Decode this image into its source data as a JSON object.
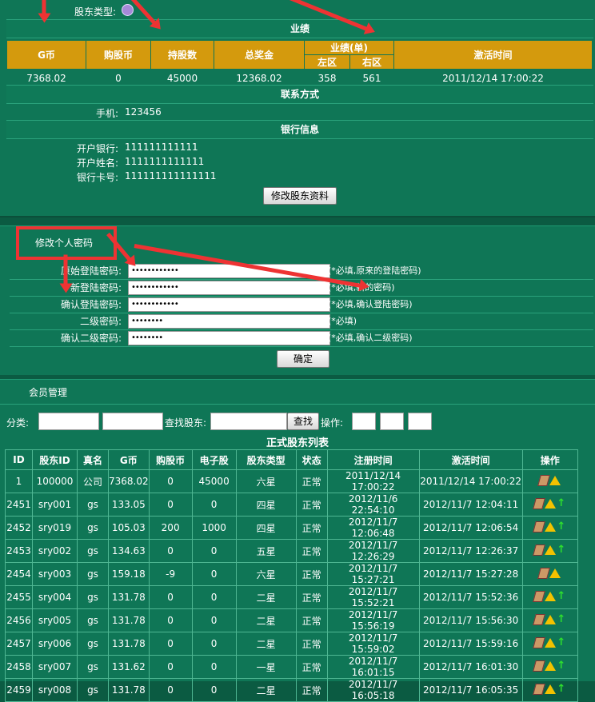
{
  "profile": {
    "type_label": "股东类型:",
    "performance_title": "业绩",
    "perf_headers": {
      "g_coin": "G币",
      "buy_coin": "购股币",
      "shares": "持股数",
      "total_bonus": "总奖金",
      "performance": "业绩(单)",
      "left": "左区",
      "right": "右区",
      "activate_time": "激活时间"
    },
    "perf_values": {
      "g_coin": "7368.02",
      "buy_coin": "0",
      "shares": "45000",
      "total_bonus": "12368.02",
      "left": "358",
      "right": "561",
      "activate_time": "2011/12/14 17:00:22"
    },
    "contact_title": "联系方式",
    "phone_label": "手机:",
    "phone_value": "123456",
    "bank_title": "银行信息",
    "bank_name_label": "开户银行:",
    "bank_name_value": "111111111111",
    "account_name_label": "开户姓名:",
    "account_name_value": "1111111111111",
    "card_label": "银行卡号:",
    "card_value": "111111111111111",
    "edit_button": "修改股东资料"
  },
  "password": {
    "title": "修改个人密码",
    "fields": [
      {
        "label": "原始登陆密码:",
        "value": "••••••••••••",
        "hint": "(*必填,原来的登陆密码)"
      },
      {
        "label": "新登陆密码:",
        "value": "••••••••••••",
        "hint": "(*必填,新的密码)"
      },
      {
        "label": "确认登陆密码:",
        "value": "••••••••••••",
        "hint": "(*必填,确认登陆密码)"
      },
      {
        "label": "二级密码:",
        "value": "••••••••",
        "hint": "(*必填)"
      },
      {
        "label": "确认二级密码:",
        "value": "••••••••",
        "hint": "(*必填,确认二级密码)"
      }
    ],
    "confirm_button": "确定"
  },
  "members": {
    "title": "会员管理",
    "category_label": "分类:",
    "find_label": "查找股东:",
    "find_button": "查找",
    "operate_label": "操作:",
    "list_title": "正式股东列表",
    "headers": [
      "ID",
      "股东ID",
      "真名",
      "G币",
      "购股币",
      "电子股",
      "股东类型",
      "状态",
      "注册时间",
      "激活时间",
      "操作"
    ],
    "rows": [
      [
        "1",
        "100000",
        "公司",
        "7368.02",
        "0",
        "45000",
        "六星",
        "正常",
        "2011/12/14 17:00:22",
        "2011/12/14 17:00:22"
      ],
      [
        "2451",
        "sry001",
        "gs",
        "133.05",
        "0",
        "0",
        "四星",
        "正常",
        "2012/11/6 22:54:10",
        "2012/11/7 12:04:11"
      ],
      [
        "2452",
        "sry019",
        "gs",
        "105.03",
        "200",
        "1000",
        "四星",
        "正常",
        "2012/11/7 12:06:48",
        "2012/11/7 12:06:54"
      ],
      [
        "2453",
        "sry002",
        "gs",
        "134.63",
        "0",
        "0",
        "五星",
        "正常",
        "2012/11/7 12:26:29",
        "2012/11/7 12:26:37"
      ],
      [
        "2454",
        "sry003",
        "gs",
        "159.18",
        "-9",
        "0",
        "六星",
        "正常",
        "2012/11/7 15:27:21",
        "2012/11/7 15:27:28"
      ],
      [
        "2455",
        "sry004",
        "gs",
        "131.78",
        "0",
        "0",
        "二星",
        "正常",
        "2012/11/7 15:52:21",
        "2012/11/7 15:52:36"
      ],
      [
        "2456",
        "sry005",
        "gs",
        "131.78",
        "0",
        "0",
        "二星",
        "正常",
        "2012/11/7 15:56:19",
        "2012/11/7 15:56:30"
      ],
      [
        "2457",
        "sry006",
        "gs",
        "131.78",
        "0",
        "0",
        "二星",
        "正常",
        "2012/11/7 15:59:02",
        "2012/11/7 15:59:16"
      ],
      [
        "2458",
        "sry007",
        "gs",
        "131.62",
        "0",
        "0",
        "一星",
        "正常",
        "2012/11/7 16:01:15",
        "2012/11/7 16:01:30"
      ],
      [
        "2459",
        "sry008",
        "gs",
        "131.78",
        "0",
        "0",
        "二星",
        "正常",
        "2012/11/7 16:05:18",
        "2012/11/7 16:05:35"
      ]
    ],
    "row_ops": [
      "edit-warn",
      "edit-warn-up",
      "edit-warn-up",
      "edit-warn-up",
      "edit-warn",
      "edit-warn-up",
      "edit-warn-up",
      "edit-warn-up",
      "edit-warn-up",
      "edit-warn-up"
    ]
  },
  "colors": {
    "page_bg": "#0b5b42",
    "panel_bg": "#0f7656",
    "header_gold": "#d49a0d",
    "annotation_red": "#e33333"
  }
}
